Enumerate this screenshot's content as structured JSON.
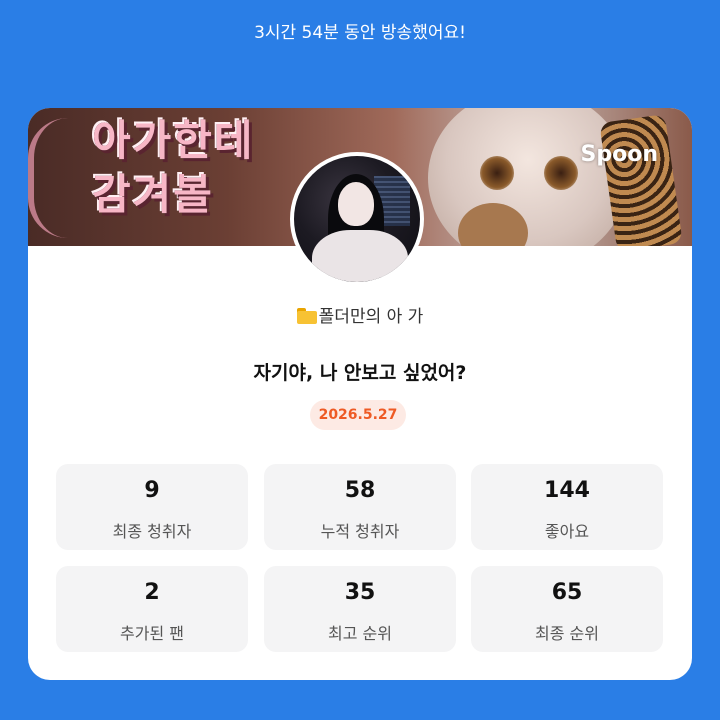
{
  "header": {
    "broadcast_duration_text": "3시간 54분 동안 방송했어요!"
  },
  "banner": {
    "title_line1": "아가한테",
    "title_line2": "감겨볼",
    "logo_text": "Spoon"
  },
  "host": {
    "folder_emoji_icon": "folder-icon",
    "name": "폴더만의 아 가"
  },
  "broadcast": {
    "title": "자기야, 나 안보고 싶었어?",
    "date": "2026.5.27"
  },
  "stats": [
    {
      "value": "9",
      "label": "최종 청취자"
    },
    {
      "value": "58",
      "label": "누적 청취자"
    },
    {
      "value": "144",
      "label": "좋아요"
    },
    {
      "value": "2",
      "label": "추가된 팬"
    },
    {
      "value": "35",
      "label": "최고 순위"
    },
    {
      "value": "65",
      "label": "최종 순위"
    }
  ],
  "colors": {
    "page_background": "#2a7ee6",
    "card_background": "#ffffff",
    "stat_box_background": "#f4f4f5",
    "date_badge_background": "#fdeae4",
    "date_badge_text": "#ee5a24"
  }
}
